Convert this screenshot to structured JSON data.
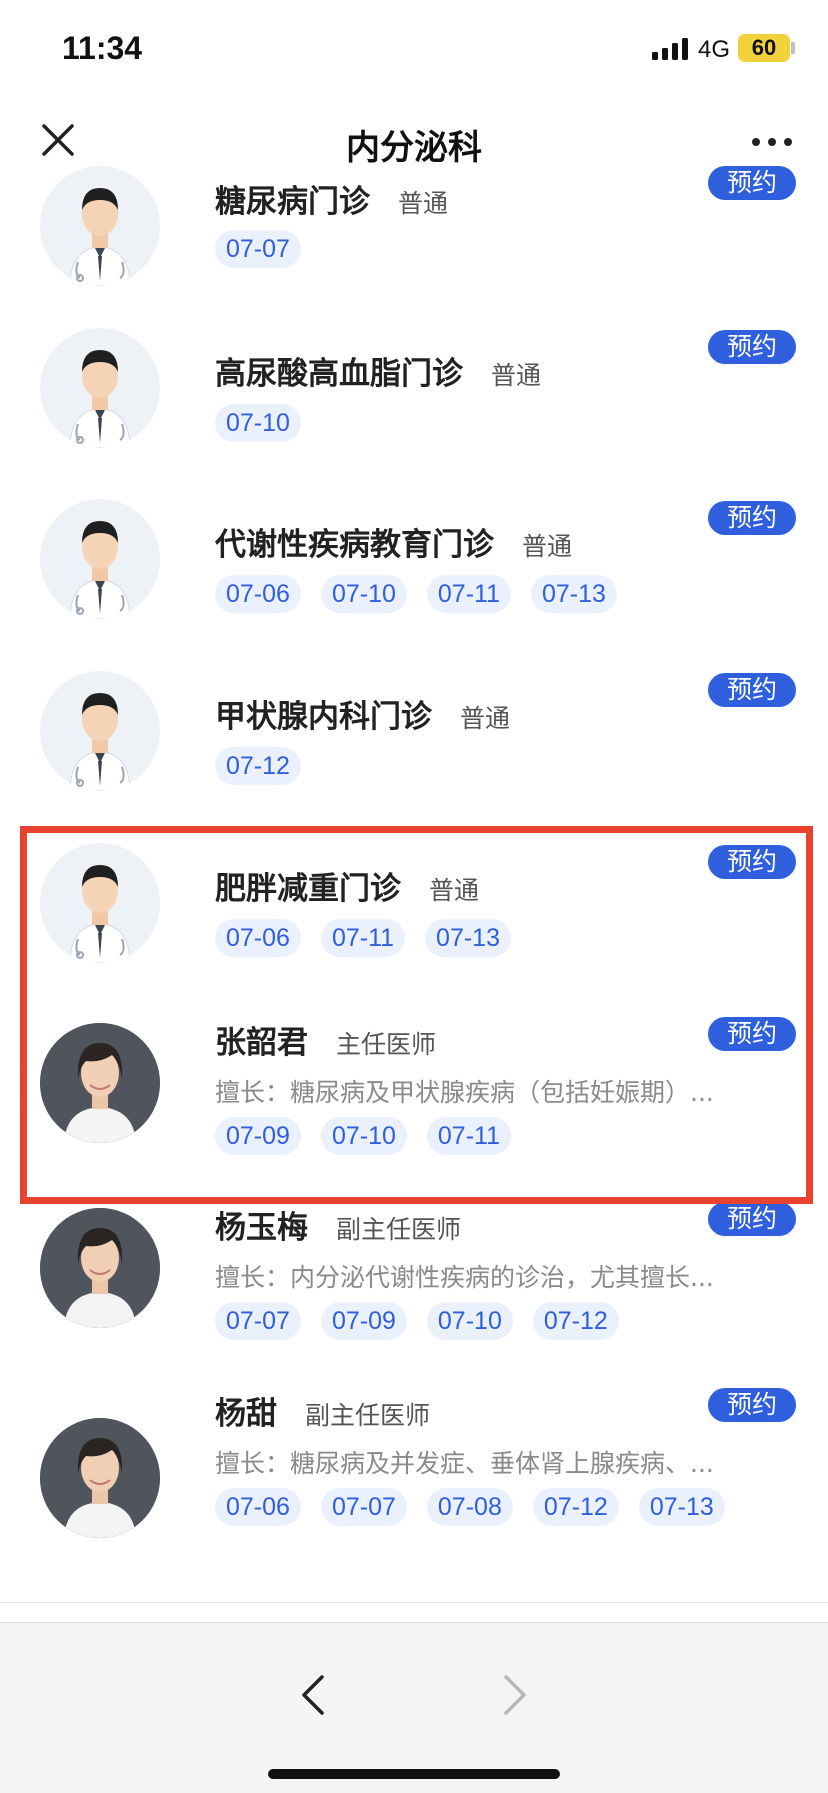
{
  "status_bar": {
    "time": "11:34",
    "network": "4G",
    "battery": "60"
  },
  "nav": {
    "title": "内分泌科"
  },
  "book_label": "预约",
  "items": [
    {
      "name": "糖尿病门诊",
      "type": "普通",
      "specialty": "",
      "dates": [
        "07-07"
      ],
      "avatar": "doctor-placeholder"
    },
    {
      "name": "高尿酸高血脂门诊",
      "type": "普通",
      "specialty": "",
      "dates": [
        "07-10"
      ],
      "avatar": "doctor-placeholder"
    },
    {
      "name": "代谢性疾病教育门诊",
      "type": "普通",
      "specialty": "",
      "dates": [
        "07-06",
        "07-10",
        "07-11",
        "07-13"
      ],
      "avatar": "doctor-placeholder"
    },
    {
      "name": "甲状腺内科门诊",
      "type": "普通",
      "specialty": "",
      "dates": [
        "07-12"
      ],
      "avatar": "doctor-placeholder"
    },
    {
      "name": "肥胖减重门诊",
      "type": "普通",
      "specialty": "",
      "dates": [
        "07-06",
        "07-11",
        "07-13"
      ],
      "avatar": "doctor-placeholder"
    },
    {
      "name": "张韶君",
      "type": "主任医师",
      "specialty": "擅长：糖尿病及甲状腺疾病（包括妊娠期）...",
      "dates": [
        "07-09",
        "07-10",
        "07-11"
      ],
      "avatar": "doctor-photo"
    },
    {
      "name": "杨玉梅",
      "type": "副主任医师",
      "specialty": "擅长：内分泌代谢性疾病的诊治，尤其擅长...",
      "dates": [
        "07-07",
        "07-09",
        "07-10",
        "07-12"
      ],
      "avatar": "doctor-photo"
    },
    {
      "name": "杨甜",
      "type": "副主任医师",
      "specialty": "擅长：糖尿病及并发症、垂体肾上腺疾病、...",
      "dates": [
        "07-06",
        "07-07",
        "07-08",
        "07-12",
        "07-13"
      ],
      "avatar": "doctor-photo"
    }
  ],
  "colors": {
    "accent": "#2f5fdc",
    "chip_bg": "#eaf0fc",
    "highlight_border": "#e8432f",
    "battery": "#f3d13a"
  }
}
